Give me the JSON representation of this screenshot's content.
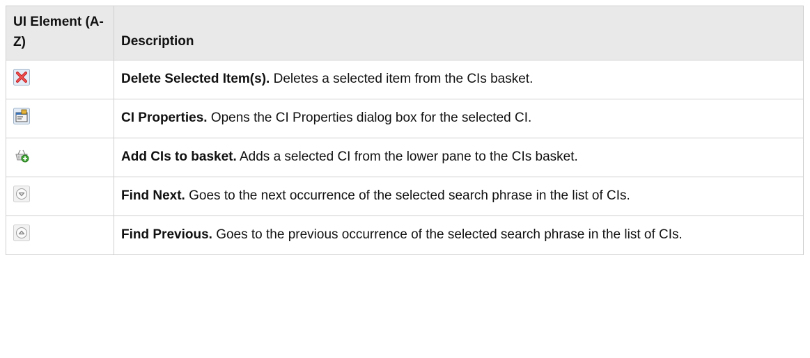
{
  "table": {
    "headers": {
      "element": "UI Element (A-Z)",
      "description": "Description"
    },
    "rows": [
      {
        "icon": "delete-icon",
        "name": "Delete Selected Item(s).",
        "text": " Deletes a selected item from the CIs basket."
      },
      {
        "icon": "ci-properties-icon",
        "name": "CI Properties.",
        "text": " Opens the CI Properties dialog box for the selected CI."
      },
      {
        "icon": "add-to-basket-icon",
        "name": "Add CIs to basket.",
        "text": " Adds a selected CI from the lower pane to the CIs basket."
      },
      {
        "icon": "find-next-icon",
        "name": "Find Next.",
        "text": " Goes to the next occurrence of the selected search phrase in the list of CIs."
      },
      {
        "icon": "find-previous-icon",
        "name": "Find Previous.",
        "text": " Goes to the previous occurrence of the selected search phrase in the list of CIs."
      }
    ]
  }
}
